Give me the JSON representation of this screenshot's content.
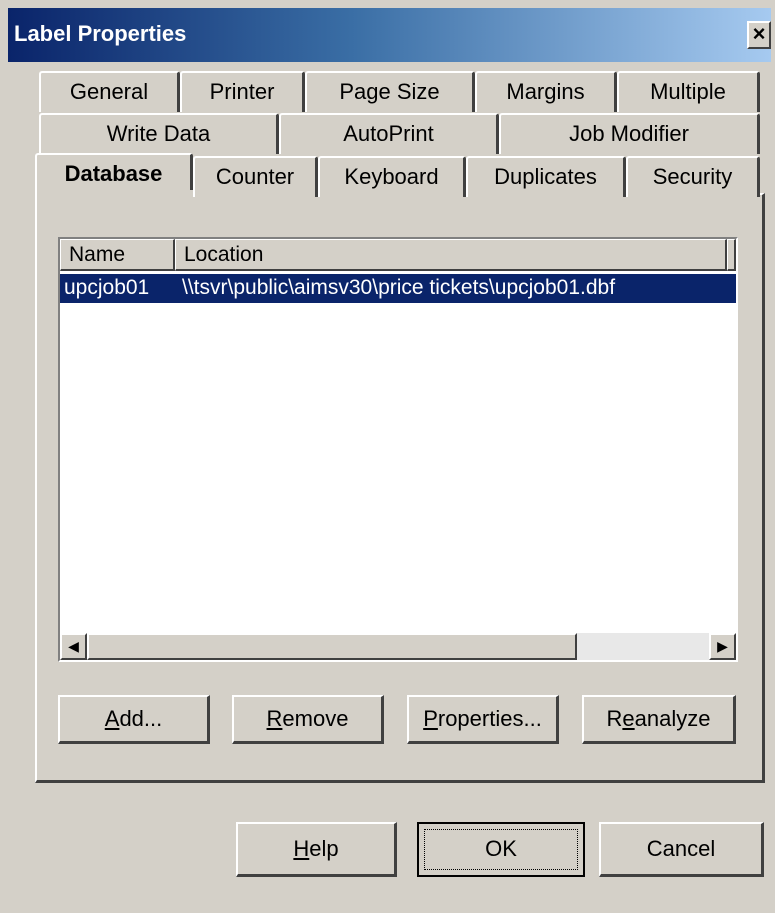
{
  "window": {
    "title": "Label Properties",
    "close_label": "×"
  },
  "tabs": {
    "row1": [
      "General",
      "Printer",
      "Page Size",
      "Margins",
      "Multiple"
    ],
    "row2": [
      "Write Data",
      "AutoPrint",
      "Job Modifier"
    ],
    "row3": [
      "Database",
      "Counter",
      "Keyboard",
      "Duplicates",
      "Security"
    ],
    "active": "Database"
  },
  "database_list": {
    "columns": [
      "Name",
      "Location"
    ],
    "rows": [
      {
        "name": "upcjob01",
        "location": "\\\\tsvr\\public\\aimsv30\\price tickets\\upcjob01.dbf",
        "selected": true
      }
    ],
    "scroll_left_glyph": "◀",
    "scroll_right_glyph": "▶"
  },
  "panel_buttons": {
    "add": {
      "mnemonic": "A",
      "rest": "dd..."
    },
    "remove": {
      "mnemonic": "R",
      "rest": "emove"
    },
    "properties": {
      "mnemonic": "P",
      "rest": "roperties..."
    },
    "reanalyze": {
      "pre": "R",
      "mnemonic": "e",
      "rest": "analyze"
    }
  },
  "dialog_buttons": {
    "help": {
      "mnemonic": "H",
      "rest": "elp"
    },
    "ok": "OK",
    "cancel": "Cancel"
  },
  "colors": {
    "face": "#d4d0c8",
    "selection": "#0a246a",
    "title_start": "#0a246a",
    "title_end": "#a6caf0"
  }
}
